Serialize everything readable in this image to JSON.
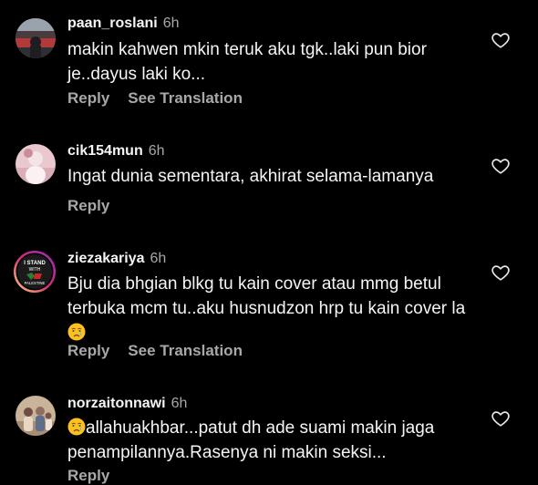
{
  "comments": [
    {
      "username": "paan_roslani",
      "time": "6h",
      "text": "makin kahwen mkin teruk aku tgk..laki pun bior je..dayus laki ko...",
      "reply_label": "Reply",
      "translate_label": "See Translation",
      "avatar_icon": "stadium-photo-avatar",
      "like_icon": "heart-outline-icon"
    },
    {
      "username": "cik154mun",
      "time": "6h",
      "text": "Ingat dunia sementara, akhirat selama-lamanya",
      "reply_label": "Reply",
      "avatar_icon": "pink-photo-avatar",
      "like_icon": "heart-outline-icon"
    },
    {
      "username": "ziezakariya",
      "time": "6h",
      "text_before_emoji": "Bju dia bhgian blkg tu kain cover atau mmg betul terbuka mcm tu..aku husnudzon hrp tu kain cover la",
      "emoji_icon": "crying-face-emoji",
      "avatar_text_lines": [
        "I STAND",
        "WITH",
        "PALESTINE"
      ],
      "reply_label": "Reply",
      "translate_label": "See Translation",
      "avatar_icon": "story-ring-avatar",
      "like_icon": "heart-outline-icon"
    },
    {
      "username": "norzaitonnawi",
      "time": "6h",
      "emoji_icon": "crying-face-emoji",
      "text_after_emoji": "allahuakhbar...patut dh ade suami makin jaga penampilannya.Rasenya ni makin seksi...",
      "reply_label": "Reply",
      "avatar_icon": "family-photo-avatar",
      "like_icon": "heart-outline-icon"
    }
  ],
  "colors": {
    "background": "#000000",
    "primary_text": "#f5f5f5",
    "secondary_text": "#a8a8a8",
    "story_ring_start": "#feda75",
    "story_ring_mid": "#d62976",
    "story_ring_end": "#962fbf"
  }
}
